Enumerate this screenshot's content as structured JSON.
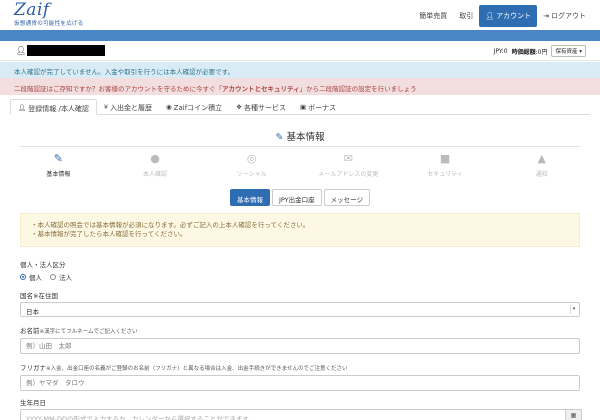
{
  "header": {
    "logo_main": "Zaif",
    "logo_sub": "仮想通貨の可能性を広げる",
    "nav": [
      {
        "label": "簡単売買"
      },
      {
        "label": "取引"
      },
      {
        "label": "アカウント",
        "icon": "user-icon"
      },
      {
        "label": "ログアウト",
        "icon": "logout-icon"
      }
    ]
  },
  "userbar": {
    "jpy_label": "JPY:",
    "jpy_value": "0",
    "valuation_label": "時価総額",
    "valuation_value": ":0円",
    "assets_select": "保有資産"
  },
  "alerts": {
    "info": "本人確認が完了していません。入金や取引を行うには本人確認が必要です。",
    "danger_prefix": "二段階認証はご存知ですか？お客様のアカウントを守るために今すぐ「",
    "danger_bold": "アカウントとセキュリティ",
    "danger_suffix": "」から二段階認証の設定を行いましょう"
  },
  "tabs": [
    {
      "label": "登録情報 /本人確認",
      "icon": "user-icon",
      "active": true
    },
    {
      "label": "入出金と履歴",
      "icon": "yen-icon"
    },
    {
      "label": "Zaifコイン積立",
      "icon": "piggy-icon"
    },
    {
      "label": "各種サービス",
      "icon": "puzzle-icon"
    },
    {
      "label": "ボーナス",
      "icon": "gift-icon"
    }
  ],
  "section_title": "基本情報",
  "steps": [
    {
      "label": "基本情報",
      "icon": "pencil-icon",
      "active": true
    },
    {
      "label": "本人確認",
      "icon": "user-icon"
    },
    {
      "label": "ソーシャル",
      "icon": "globe-icon"
    },
    {
      "label": "メールアドレスの変更",
      "icon": "envelope-icon"
    },
    {
      "label": "セキュリティ",
      "icon": "lock-icon"
    },
    {
      "label": "通知",
      "icon": "bell-icon"
    }
  ],
  "subbuttons": [
    {
      "label": "基本情報",
      "active": true
    },
    {
      "label": "JPY出金口座"
    },
    {
      "label": "メッセージ"
    }
  ],
  "notice": [
    "・本人確認の照会では基本情報が必須になります。必ずご記入の上本人確認を行ってください。",
    "・基本情報が完了したら本人確認を行ってください。"
  ],
  "form": {
    "entity_label": "個人・法人区分",
    "entity_options": [
      "個人",
      "法人"
    ],
    "country_label": "国名※在住国",
    "country_value": "日本",
    "name_label": "お名前",
    "name_note": "※漢字にてフルネームでご記入ください",
    "name_placeholder": "例）山田　太郎",
    "kana_label": "フリガナ",
    "kana_note": "※入金、出金口座の名義がご登録のお名前（フリガナ）と異なる場合は入金、出金手続きができませんのでご注意ください",
    "kana_placeholder": "例）ヤマダ　タロウ",
    "birth_label": "生年月日",
    "birth_placeholder": "YYYY-MM-DDの形式で入力するか、カレンダーから選択することができます"
  }
}
